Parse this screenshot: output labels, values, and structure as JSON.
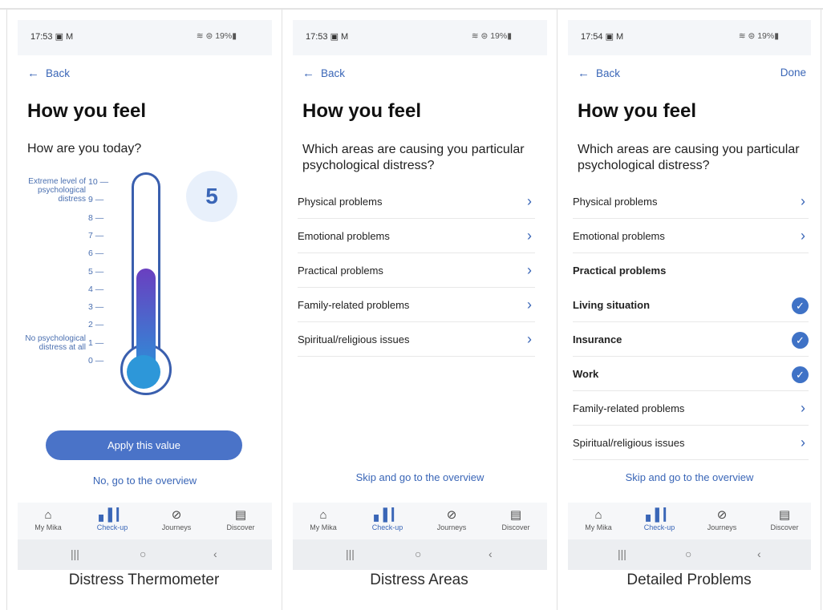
{
  "screens": [
    {
      "time": "17:53",
      "status_icons": "⊜ 19%▮",
      "back_label": "Back",
      "title": "How you feel",
      "question": "How are you today?",
      "scale_top_label": "Extreme level of psychological distress",
      "scale_bottom_label": "No psychological distress at all",
      "ticks": [
        "10",
        "9",
        "8",
        "7",
        "6",
        "5",
        "4",
        "3",
        "2",
        "1",
        "0"
      ],
      "value": "5",
      "level": 5,
      "level_max": 10,
      "apply_label": "Apply this value",
      "overview_label": "No, go to the overview",
      "caption": "Distress Thermometer"
    },
    {
      "time": "17:53",
      "status_icons": "⊜ 19%▮",
      "back_label": "Back",
      "title": "How you feel",
      "question": "Which areas are causing you particular psychological distress?",
      "items": [
        "Physical problems",
        "Emotional problems",
        "Practical problems",
        "Family-related problems",
        "Spiritual/religious issues"
      ],
      "skip_label": "Skip and go to the overview",
      "caption": "Distress Areas"
    },
    {
      "time": "17:54",
      "status_icons": "⊜ 19%▮",
      "back_label": "Back",
      "done_label": "Done",
      "title": "How you feel",
      "question": "Which areas are causing you particular psychological distress?",
      "items": [
        {
          "label": "Physical problems",
          "kind": "chevron"
        },
        {
          "label": "Emotional problems",
          "kind": "chevron"
        },
        {
          "label": "Practical problems",
          "kind": "header"
        },
        {
          "label": "Living situation",
          "kind": "checked"
        },
        {
          "label": "Insurance",
          "kind": "checked"
        },
        {
          "label": "Work",
          "kind": "checked"
        },
        {
          "label": "Family-related problems",
          "kind": "chevron"
        },
        {
          "label": "Spiritual/religious issues",
          "kind": "chevron"
        }
      ],
      "skip_label": "Skip and go to the overview",
      "caption": "Detailed Problems"
    }
  ],
  "tabs": [
    "My Mika",
    "Check-up",
    "Journeys",
    "Discover"
  ],
  "active_tab": "Check-up",
  "colors": {
    "accent": "#3a66b7",
    "button": "#4a73c8",
    "fill_top": "#6a3fc0",
    "fill_bottom": "#2d8fd8"
  }
}
